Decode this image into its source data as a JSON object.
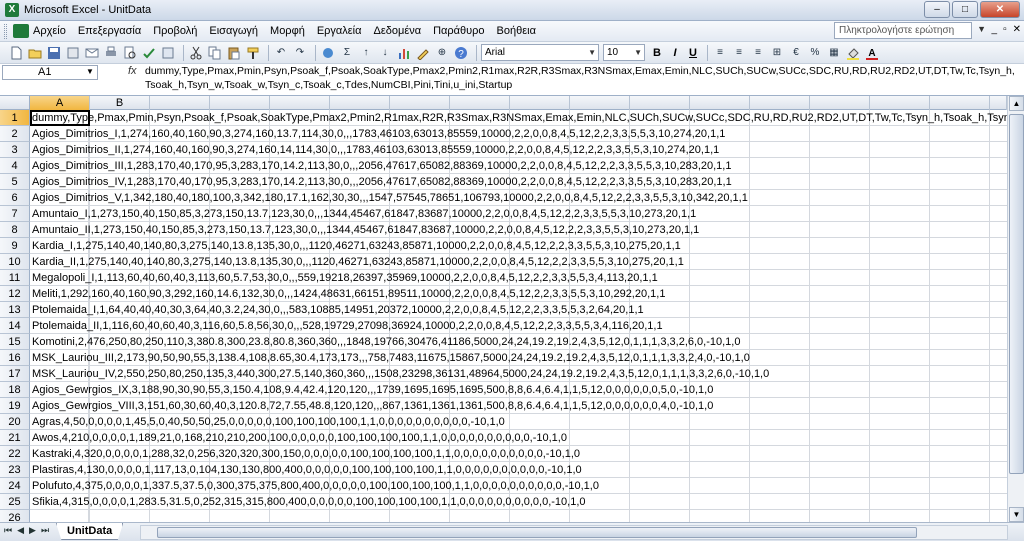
{
  "window": {
    "title": "Microsoft Excel - UnitData",
    "app_icon_letter": "X",
    "min": "–",
    "max": "□",
    "close": "✕"
  },
  "menu": {
    "items": [
      "Αρχείο",
      "Επεξεργασία",
      "Προβολή",
      "Εισαγωγή",
      "Μορφή",
      "Εργαλεία",
      "Δεδομένα",
      "Παράθυρο",
      "Βοήθεια"
    ],
    "help_placeholder": "Πληκτρολογήστε ερώτηση"
  },
  "toolbar": {
    "font": "Arial",
    "size": "10",
    "bold": "B",
    "italic": "I",
    "underline": "U",
    "sigma": "Σ",
    "euro": "€"
  },
  "formula_bar": {
    "name_box": "A1",
    "fx": "fx",
    "content": "dummy,Type,Pmax,Pmin,Psyn,Psoak_f,Psoak,SoakType,Pmax2,Pmin2,R1max,R2R,R3Smax,R3NSmax,Emax,Emin,NLC,SUCh,SUCw,SUCc,SDC,RU,RD,RU2,RD2,UT,DT,Tw,Tc,Tsyn_h,Tsoak_h,Tsyn_w,Tsoak_w,Tsyn_c,Tsoak_c,Tdes,NumCBI,Pini,Tini,u_ini,Startup"
  },
  "grid": {
    "columns": [
      "A",
      "B",
      "C",
      "D",
      "E",
      "F",
      "G",
      "H",
      "I",
      "J",
      "K",
      "L",
      "M",
      "N",
      "O",
      "P",
      "Q"
    ],
    "rows": [
      {
        "n": "1",
        "text": "dummy,Type,Pmax,Pmin,Psyn,Psoak_f,Psoak,SoakType,Pmax2,Pmin2,R1max,R2R,R3Smax,R3NSmax,Emax,Emin,NLC,SUCh,SUCw,SUCc,SDC,RU,RD,RU2,RD2,UT,DT,Tw,Tc,Tsyn_h,Tsoak_h,Tsyn_w,Tsoak_w,Tsyn_c,Tsoak_c,Tdes,NumCBI,Pini,Tini,u_ini,Startup"
      },
      {
        "n": "2",
        "text": "Agios_Dimitrios_I,1,274,160,40,160,90,3,274,160,13.7,114,30,0,,,1783,46103,63013,85559,10000,2,2,0,0,8,4,5,12,2,2,3,3,5,5,3,10,274,20,1,1"
      },
      {
        "n": "3",
        "text": "Agios_Dimitrios_II,1,274,160,40,160,90,3,274,160,14,114,30,0,,,1783,46103,63013,85559,10000,2,2,0,0,8,4,5,12,2,2,3,3,5,5,3,10,274,20,1,1"
      },
      {
        "n": "4",
        "text": "Agios_Dimitrios_III,1,283,170,40,170,95,3,283,170,14.2,113,30,0,,,2056,47617,65082,88369,10000,2,2,0,0,8,4,5,12,2,2,3,3,5,5,3,10,283,20,1,1"
      },
      {
        "n": "5",
        "text": "Agios_Dimitrios_IV,1,283,170,40,170,95,3,283,170,14.2,113,30,0,,,2056,47617,65082,88369,10000,2,2,0,0,8,4,5,12,2,2,3,3,5,5,3,10,283,20,1,1"
      },
      {
        "n": "6",
        "text": "Agios_Dimitrios_V,1,342,180,40,180,100,3,342,180,17.1,162,30,30,,,1547,57545,78651,106793,10000,2,2,0,0,8,4,5,12,2,2,3,3,5,5,3,10,342,20,1,1"
      },
      {
        "n": "7",
        "text": "Amuntaio_I,1,273,150,40,150,85,3,273,150,13.7,123,30,0,,,1344,45467,61847,83687,10000,2,2,0,0,8,4,5,12,2,2,3,3,5,5,3,10,273,20,1,1"
      },
      {
        "n": "8",
        "text": "Amuntaio_II,1,273,150,40,150,85,3,273,150,13.7,123,30,0,,,1344,45467,61847,83687,10000,2,2,0,0,8,4,5,12,2,2,3,3,5,5,3,10,273,20,1,1"
      },
      {
        "n": "9",
        "text": "Kardia_I,1,275,140,40,140,80,3,275,140,13.8,135,30,0,,,1120,46271,63243,85871,10000,2,2,0,0,8,4,5,12,2,2,3,3,5,5,3,10,275,20,1,1"
      },
      {
        "n": "10",
        "text": "Kardia_II,1,275,140,40,140,80,3,275,140,13.8,135,30,0,,,1120,46271,63243,85871,10000,2,2,0,0,8,4,5,12,2,2,3,3,5,5,3,10,275,20,1,1"
      },
      {
        "n": "11",
        "text": "Megalopoli_I,1,113,60,40,60,40,3,113,60,5.7,53,30,0,,,559,19218,26397,35969,10000,2,2,0,0,8,4,5,12,2,2,3,3,5,5,3,4,113,20,1,1"
      },
      {
        "n": "12",
        "text": "Meliti,1,292,160,40,160,90,3,292,160,14.6,132,30,0,,,1424,48631,66151,89511,10000,2,2,0,0,8,4,5,12,2,2,3,3,5,5,3,10,292,20,1,1"
      },
      {
        "n": "13",
        "text": "Ptolemaida_I,1,64,40,40,40,30,3,64,40,3.2,24,30,0,,,583,10885,14951,20372,10000,2,2,0,0,8,4,5,12,2,2,3,3,5,5,3,2,64,20,1,1"
      },
      {
        "n": "14",
        "text": "Ptolemaida_II,1,116,60,40,60,40,3,116,60,5.8,56,30,0,,,528,19729,27098,36924,10000,2,2,0,0,8,4,5,12,2,2,3,3,5,5,3,4,116,20,1,1"
      },
      {
        "n": "15",
        "text": "Komotini,2,476,250,80,250,110,3,380.8,300,23.8,80.8,360,360,,,1848,19766,30476,41186,5000,24,24,19.2,19.2,4,3,5,12,0,1,1,1,3,3,2,6,0,-10,1,0"
      },
      {
        "n": "16",
        "text": "MSK_Lauriou_III,2,173,90,50,90,55,3,138.4,108,8.65,30.4,173,173,,,758,7483,11675,15867,5000,24,24,19.2,19.2,4,3,5,12,0,1,1,1,3,3,2,4,0,-10,1,0"
      },
      {
        "n": "17",
        "text": "MSK_Lauriou_IV,2,550,250,80,250,135,3,440,300,27.5,140,360,360,,,1508,23298,36131,48964,5000,24,24,19.2,19.2,4,3,5,12,0,1,1,1,3,3,2,6,0,-10,1,0"
      },
      {
        "n": "18",
        "text": "Agios_Gewrgios_IX,3,188,90,30,90,55,3,150.4,108,9.4,42.4,120,120,,,1739,1695,1695,1695,500,8,8,6.4,6.4,1,1,5,12,0,0,0,0,0,0,5,0,-10,1,0"
      },
      {
        "n": "19",
        "text": "Agios_Gewrgios_VIII,3,151,60,30,60,40,3,120.8,72,7.55,48.8,120,120,,,867,1361,1361,1361,500,8,8,6.4,6.4,1,1,5,12,0,0,0,0,0,0,4,0,-10,1,0"
      },
      {
        "n": "20",
        "text": "Agras,4,50,0,0,0,0,1,45,5,0,40,50,50,25,0,0,0,0,0,100,100,100,100,1,1,0,0,0,0,0,0,0,0,0,0,-10,1,0"
      },
      {
        "n": "21",
        "text": "Awos,4,210,0,0,0,0,1,189,21,0,168,210,210,200,100,0,0,0,0,0,100,100,100,100,1,1,0,0,0,0,0,0,0,0,0,0,-10,1,0"
      },
      {
        "n": "22",
        "text": "Kastraki,4,320,0,0,0,0,1,288,32,0,256,320,320,300,150,0,0,0,0,0,100,100,100,100,1,1,0,0,0,0,0,0,0,0,0,0,-10,1,0"
      },
      {
        "n": "23",
        "text": "Plastiras,4,130,0,0,0,0,1,117,13,0,104,130,130,800,400,0,0,0,0,0,100,100,100,100,1,1,0,0,0,0,0,0,0,0,0,0,-10,1,0"
      },
      {
        "n": "24",
        "text": "Polufuto,4,375,0,0,0,0,1,337.5,37.5,0,300,375,375,800,400,0,0,0,0,0,100,100,100,100,1,1,0,0,0,0,0,0,0,0,0,0,-10,1,0"
      },
      {
        "n": "25",
        "text": "Sfikia,4,315,0,0,0,0,1,283.5,31.5,0,252,315,315,800,400,0,0,0,0,0,100,100,100,100,1,1,0,0,0,0,0,0,0,0,0,0,-10,1,0"
      },
      {
        "n": "26",
        "text": ""
      },
      {
        "n": "27",
        "text": ""
      },
      {
        "n": "28",
        "text": ""
      }
    ]
  },
  "sheet_tabs": {
    "active": "UnitData",
    "nav": [
      "⏮",
      "◀",
      "▶",
      "⏭"
    ]
  },
  "colors": {
    "selection_header": "#f1b640",
    "title_gradient": "#ccd8e8",
    "grid_line": "#d4d8de"
  }
}
